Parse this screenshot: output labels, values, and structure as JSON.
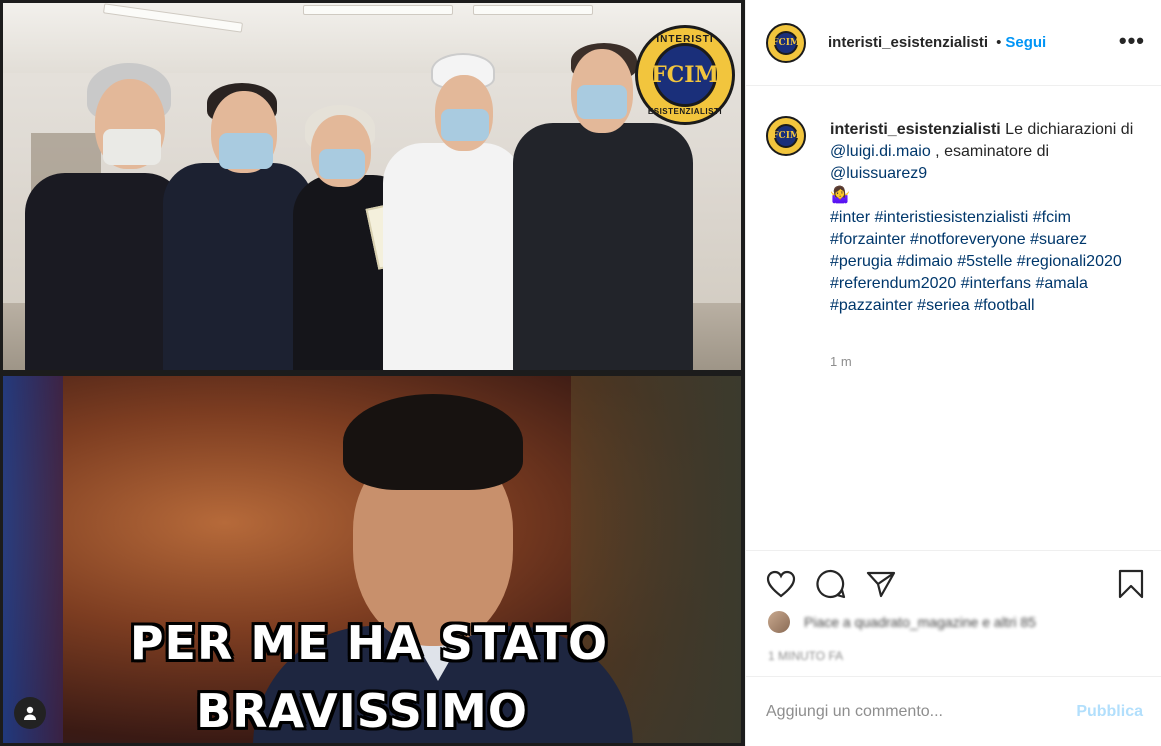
{
  "post": {
    "username": "interisti_esistenzialisti",
    "follow_label": "Segui",
    "more_icon": "more-dots-icon",
    "avatar_text": "FCIM"
  },
  "media": {
    "badge_top": "INTERISTI",
    "badge_bottom": "ESISTENZIALISTI",
    "badge_center": "FCIM",
    "meme_line_1": "PER ME HA STATO",
    "meme_line_2": "BRAVISSIMO",
    "tag_icon": "user-tag-icon"
  },
  "caption": {
    "username": "interisti_esistenzialisti",
    "text_1": " Le dichiarazioni di ",
    "mention_1": "@luigi.di.maio",
    "text_2": " , esaminatore di ",
    "mention_2": "@luissuarez9",
    "emoji": "🤷‍♀️",
    "hashtags": "#inter #interistiesistenzialisti #fcim #forzainter #notforeveryone #suarez #perugia #dimaio #5stelle #regionali2020 #referendum2020 #interfans #amala #pazzainter #seriea #football",
    "time": "1 m"
  },
  "actions": {
    "icons": [
      "heart-icon",
      "comment-icon",
      "share-icon",
      "bookmark-icon"
    ],
    "likes_text": "Piace a quadrato_magazine e altri 85",
    "likes_sub": "1 MINUTO FA"
  },
  "comment": {
    "placeholder": "Aggiungi un commento...",
    "publish_label": "Pubblica"
  }
}
